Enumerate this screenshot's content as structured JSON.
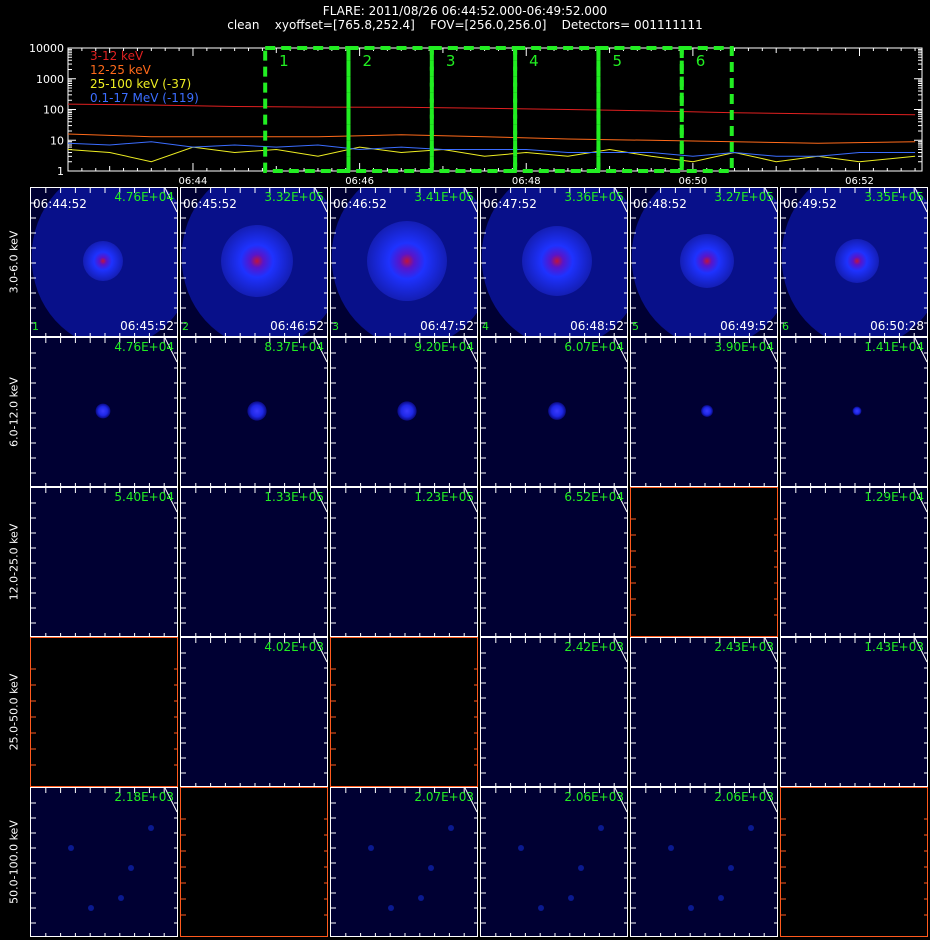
{
  "header": {
    "line1": "FLARE: 2011/08/26 06:44:52.000-06:49:52.000",
    "line2": "clean    xyoffset=[765.8,252.4]    FOV=[256.0,256.0]    Detectors= 001111111"
  },
  "chart_data": [
    {
      "type": "line",
      "yscale": "log",
      "ylim": [
        1,
        10000
      ],
      "y_ticks": [
        "1",
        "10",
        "100",
        "1000",
        "10000"
      ],
      "x_ticks": [
        "06:44",
        "06:46",
        "06:48",
        "06:50",
        "06:52"
      ],
      "xlim": [
        "06:42:30",
        "06:52:45"
      ],
      "series": [
        {
          "name": "3-12 keV",
          "color": "#e02020",
          "x": [
            "06:42:30",
            "06:43:30",
            "06:44:30",
            "06:45:30",
            "06:46:30",
            "06:47:30",
            "06:48:30",
            "06:49:30",
            "06:50:30",
            "06:51:30",
            "06:52:40"
          ],
          "y": [
            150,
            140,
            125,
            120,
            118,
            110,
            100,
            90,
            78,
            72,
            68
          ]
        },
        {
          "name": "12-25 keV",
          "color": "#ff6a1a",
          "x": [
            "06:42:30",
            "06:43:30",
            "06:44:30",
            "06:45:30",
            "06:46:30",
            "06:47:30",
            "06:48:30",
            "06:49:30",
            "06:50:30",
            "06:51:30",
            "06:52:40"
          ],
          "y": [
            16,
            13,
            13,
            13,
            15,
            13,
            11,
            10,
            9,
            8,
            9
          ]
        },
        {
          "name": "25-100 keV (-37)",
          "color": "#eeee22",
          "x": [
            "06:42:30",
            "06:43:00",
            "06:43:30",
            "06:44:00",
            "06:44:30",
            "06:45:00",
            "06:45:30",
            "06:46:00",
            "06:46:30",
            "06:47:00",
            "06:47:30",
            "06:48:00",
            "06:48:30",
            "06:49:00",
            "06:49:30",
            "06:50:00",
            "06:50:30",
            "06:51:00",
            "06:51:30",
            "06:52:00",
            "06:52:40"
          ],
          "y": [
            5,
            4,
            2,
            6,
            4,
            5,
            3,
            6,
            4,
            5,
            3,
            4,
            3,
            5,
            3,
            2,
            4,
            2,
            3,
            2,
            3
          ]
        },
        {
          "name": "0.1-17 MeV (-119)",
          "color": "#3b6dff",
          "x": [
            "06:42:30",
            "06:43:00",
            "06:43:30",
            "06:44:00",
            "06:44:30",
            "06:45:00",
            "06:45:30",
            "06:46:00",
            "06:46:30",
            "06:47:00",
            "06:47:30",
            "06:48:00",
            "06:48:30",
            "06:49:00",
            "06:49:30",
            "06:50:00",
            "06:50:30",
            "06:51:00",
            "06:51:30",
            "06:52:00",
            "06:52:40"
          ],
          "y": [
            8,
            7,
            9,
            6,
            7,
            6,
            7,
            5,
            6,
            5,
            5,
            5,
            4,
            4,
            4,
            3,
            4,
            3,
            3,
            4,
            4
          ]
        }
      ],
      "intervals": [
        {
          "label": "1",
          "start": "06:44:52",
          "end": "06:45:52"
        },
        {
          "label": "2",
          "start": "06:45:52",
          "end": "06:46:52"
        },
        {
          "label": "3",
          "start": "06:46:52",
          "end": "06:47:52"
        },
        {
          "label": "4",
          "start": "06:47:52",
          "end": "06:48:52"
        },
        {
          "label": "5",
          "start": "06:48:52",
          "end": "06:49:52"
        },
        {
          "label": "6",
          "start": "06:49:52",
          "end": "06:50:28"
        }
      ],
      "interval_color": "#22ee22"
    },
    {
      "type": "heatmap",
      "energy_bands": [
        "3.0-6.0 keV",
        "6.0-12.0 keV",
        "12.0-25.0 keV",
        "25.0-50.0 keV",
        "50.0-100.0 keV"
      ],
      "time_starts": [
        "06:44:52",
        "06:45:52",
        "06:46:52",
        "06:47:52",
        "06:48:52",
        "06:49:52"
      ],
      "time_ends": [
        "06:45:52",
        "06:46:52",
        "06:47:52",
        "06:48:52",
        "06:49:52",
        "06:50:28"
      ],
      "interval_labels": [
        "1",
        "2",
        "3",
        "4",
        "5",
        "6"
      ],
      "peaks": [
        [
          "4.76E+04",
          "3.32E+05",
          "3.41E+05",
          "3.36E+05",
          "3.27E+05",
          "3.35E+05"
        ],
        [
          "4.76E+04",
          "8.37E+04",
          "9.20E+04",
          "6.07E+04",
          "3.90E+04",
          "1.41E+04"
        ],
        [
          "5.40E+04",
          "1.33E+05",
          "1.23E+05",
          "6.52E+04",
          "",
          "1.29E+04"
        ],
        [
          "",
          "4.02E+03",
          "",
          "2.42E+03",
          "2.43E+03",
          "1.43E+03"
        ],
        [
          "2.18E+03",
          "",
          "2.07E+03",
          "2.06E+03",
          "2.06E+03",
          ""
        ]
      ],
      "source_size": [
        [
          0.2,
          0.36,
          0.4,
          0.35,
          0.27,
          0.22
        ],
        [
          0.1,
          0.13,
          0.13,
          0.12,
          0.08,
          0.06
        ],
        [
          0,
          0,
          0,
          0,
          0,
          0
        ],
        [
          0,
          0,
          0,
          0,
          0,
          0
        ],
        [
          0,
          0,
          0,
          0,
          0,
          0
        ]
      ],
      "empty": [
        [
          false,
          false,
          false,
          false,
          false,
          false
        ],
        [
          false,
          false,
          false,
          false,
          false,
          false
        ],
        [
          false,
          false,
          false,
          false,
          true,
          false
        ],
        [
          true,
          false,
          true,
          false,
          false,
          false
        ],
        [
          false,
          true,
          false,
          false,
          false,
          true
        ]
      ]
    }
  ]
}
